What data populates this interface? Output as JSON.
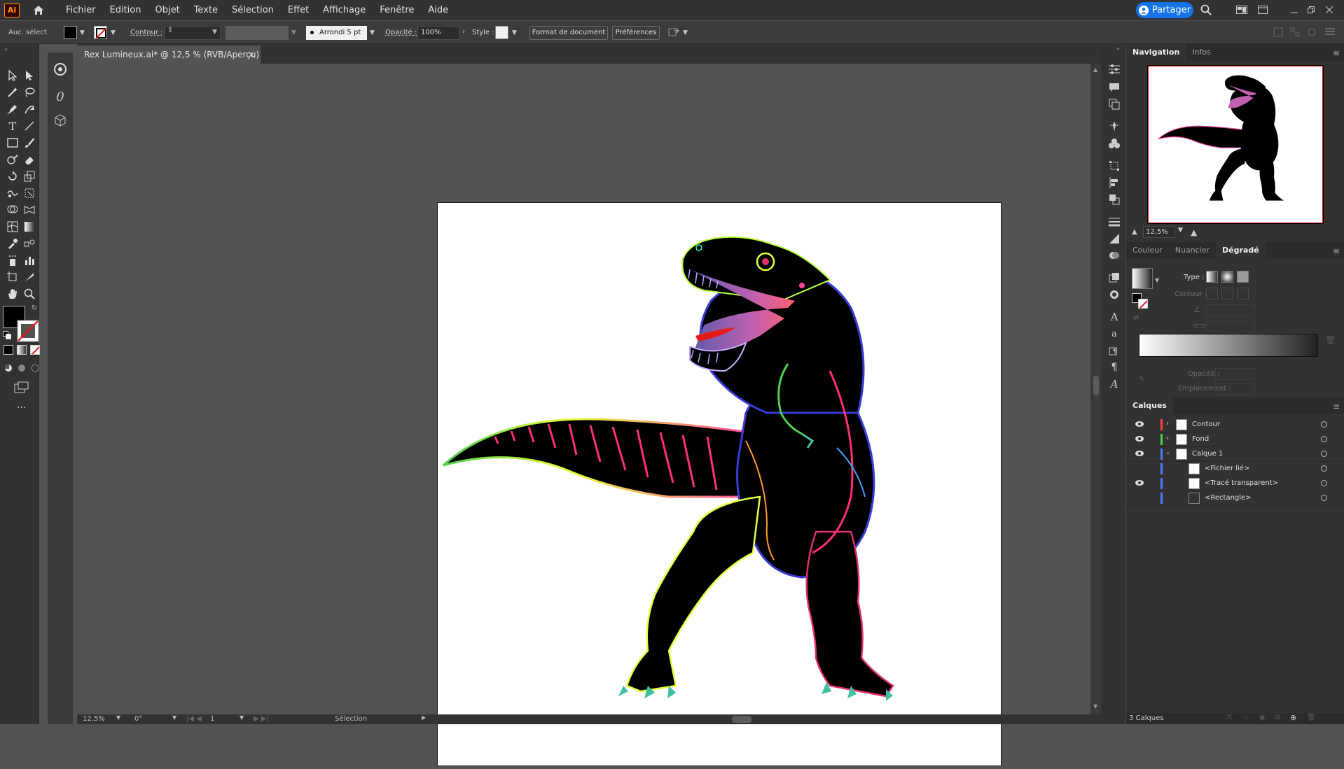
{
  "app": {
    "logo": "Ai",
    "menu": [
      "Fichier",
      "Edition",
      "Objet",
      "Texte",
      "Sélection",
      "Effet",
      "Affichage",
      "Fenêtre",
      "Aide"
    ],
    "share_label": "Partager"
  },
  "controlbar": {
    "selection_label": "Auc. sélect.",
    "stroke_label": "Contour :",
    "brush_label": "Arrondi 5 pt",
    "opacity_label": "Opacité :",
    "opacity_value": "100%",
    "style_label": "Style :",
    "doc_format_label": "Format de document",
    "prefs_label": "Préférences"
  },
  "document": {
    "tab_title": "Rex Lumineux.ai* @ 12,5 % (RVB/Aperçu)"
  },
  "statusbar": {
    "zoom": "12,5%",
    "rotation": "0°",
    "artboard": "1",
    "mode": "Sélection"
  },
  "navigation": {
    "tabs": [
      "Navigation",
      "Infos"
    ],
    "zoom": "12,5%"
  },
  "color_panel": {
    "tabs": [
      "Couleur",
      "Nuancier",
      "Dégradé"
    ],
    "type_label": "Type :",
    "stroke_label": "Contour :",
    "opacity_label": "Opacité :",
    "location_label": "Emplacement :"
  },
  "layers": {
    "title": "Calques",
    "rows": [
      {
        "name": "Contour",
        "color": "#ff4040",
        "indent": 0,
        "expanded": false,
        "visible": true
      },
      {
        "name": "Fond",
        "color": "#4fd04f",
        "indent": 0,
        "expanded": false,
        "visible": true
      },
      {
        "name": "Calque 1",
        "color": "#4f7cff",
        "indent": 0,
        "expanded": true,
        "visible": true
      },
      {
        "name": "<Fichier lié>",
        "color": "#4f7cff",
        "indent": 1,
        "expanded": false,
        "visible": false
      },
      {
        "name": "<Tracé transparent>",
        "color": "#4f7cff",
        "indent": 1,
        "expanded": false,
        "visible": true
      },
      {
        "name": "<Rectangle>",
        "color": "#4f7cff",
        "indent": 1,
        "expanded": false,
        "visible": false
      }
    ],
    "count_label": "3 Calques"
  }
}
